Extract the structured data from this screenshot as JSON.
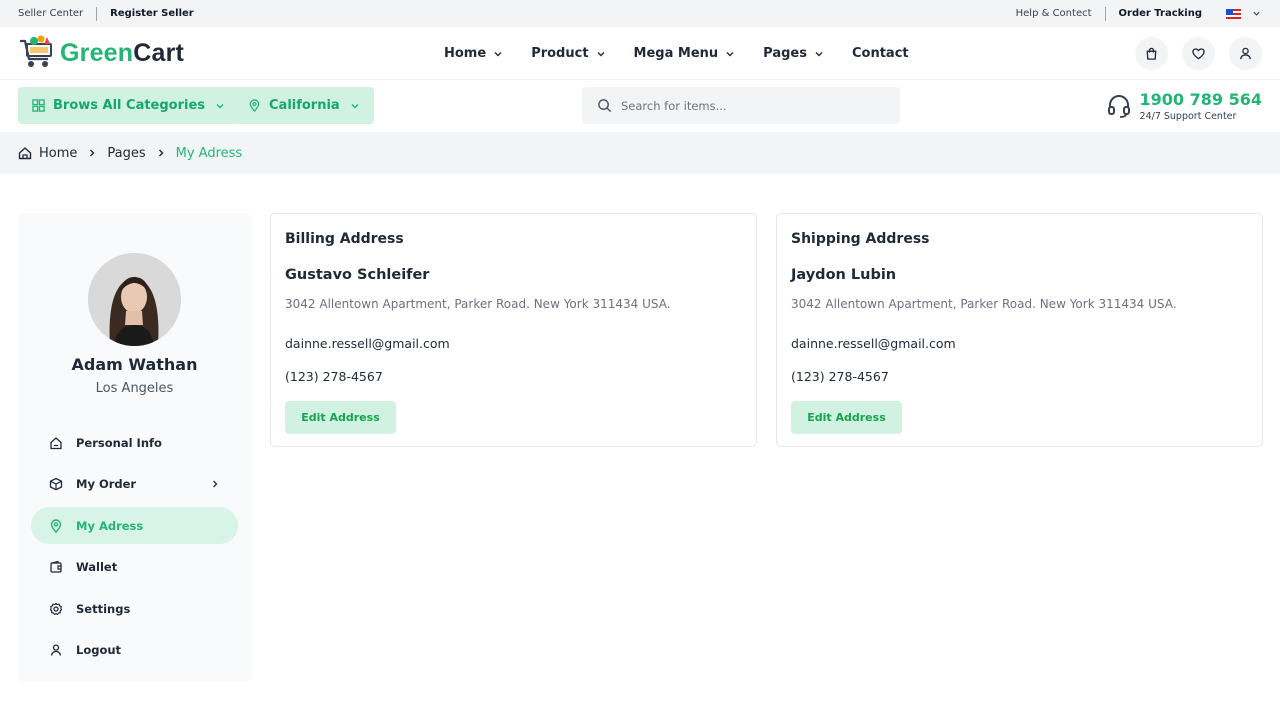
{
  "topbar": {
    "seller_center": "Seller Center",
    "register_seller": "Register Seller",
    "help": "Help & Contect",
    "order_tracking": "Order Tracking"
  },
  "brand": {
    "name_part1": "Green",
    "name_part2": "Cart"
  },
  "nav": {
    "items": [
      {
        "label": "Home",
        "dropdown": true
      },
      {
        "label": "Product",
        "dropdown": true
      },
      {
        "label": "Mega Menu",
        "dropdown": true
      },
      {
        "label": "Pages",
        "dropdown": true
      },
      {
        "label": "Contact",
        "dropdown": false
      }
    ]
  },
  "toolbar": {
    "categories_label": "Brows All Categories",
    "location_label": "California",
    "search_placeholder": "Search for items...",
    "support_phone": "1900 789 564",
    "support_text": "24/7 Support Center"
  },
  "breadcrumb": {
    "home": "Home",
    "pages": "Pages",
    "current": "My Adress"
  },
  "profile": {
    "name": "Adam Wathan",
    "city": "Los Angeles"
  },
  "menu": {
    "items": [
      {
        "label": "Personal Info",
        "icon": "home-icon"
      },
      {
        "label": "My Order",
        "icon": "box-icon"
      },
      {
        "label": "My Adress",
        "icon": "location-pin-icon"
      },
      {
        "label": "Wallet",
        "icon": "wallet-icon"
      },
      {
        "label": "Settings",
        "icon": "gear-icon"
      },
      {
        "label": "Logout",
        "icon": "user-icon"
      }
    ]
  },
  "billing": {
    "title": "Billing Address",
    "name": "Gustavo Schleifer",
    "address": "3042 Allentown Apartment, Parker Road. New York 311434 USA.",
    "email": "dainne.ressell@gmail.com",
    "phone": "(123) 278-4567",
    "button": "Edit Address"
  },
  "shipping": {
    "title": "Shipping Address",
    "name": "Jaydon Lubin",
    "address": "3042 Allentown Apartment, Parker Road. New York 311434 USA.",
    "email": "dainne.ressell@gmail.com",
    "phone": "(123) 278-4567",
    "button": "Edit Address"
  },
  "colors": {
    "accent": "#22b573",
    "accent_light": "#d1f2e3",
    "text": "#1f2937",
    "muted": "#6b7280"
  }
}
